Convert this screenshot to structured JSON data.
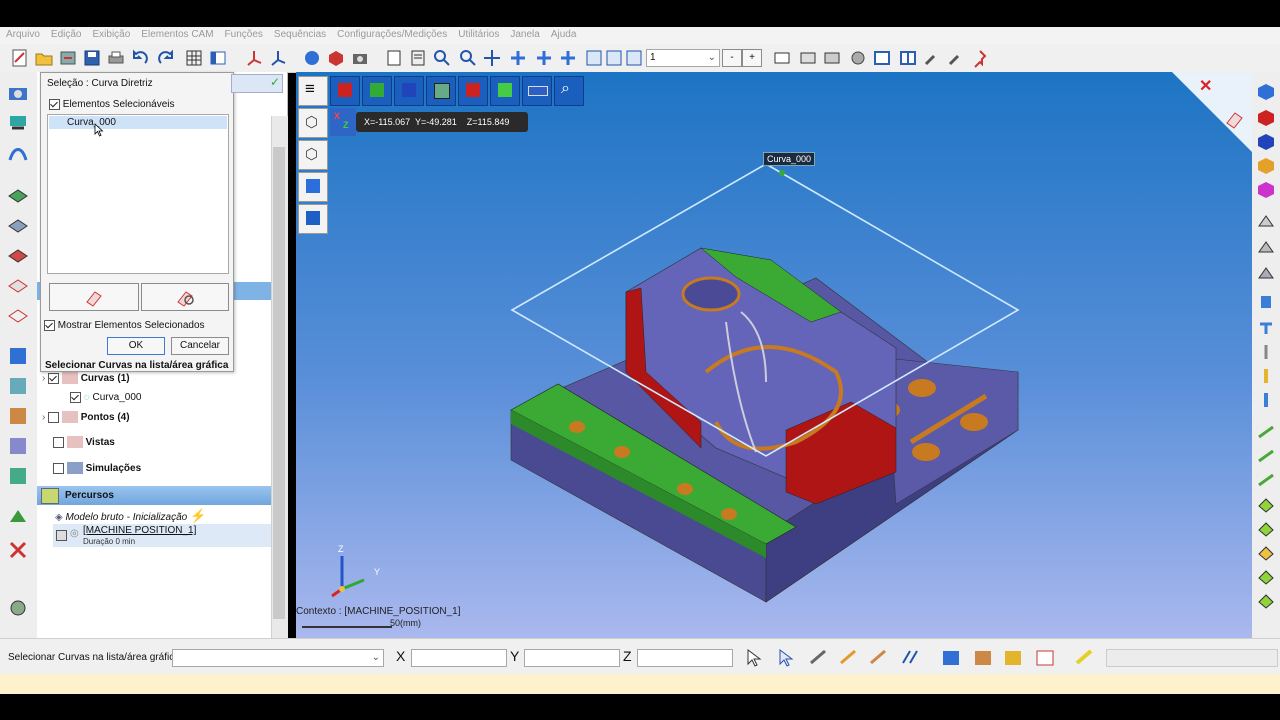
{
  "menu": [
    "Arquivo",
    "Edição",
    "Exibição",
    "Elementos CAM",
    "Funções",
    "Sequências",
    "Configurações/Medições",
    "Utilitários",
    "Janela",
    "Ajuda"
  ],
  "toolbar": {
    "layer_value": "1",
    "minus": "-",
    "plus": "+"
  },
  "dialog": {
    "title": "Seleção : Curva Diretriz",
    "selectable_label": "Elementos Selecionáveis",
    "list_items": [
      "Curva_000"
    ],
    "show_selected_label": "Mostrar Elementos Selecionados",
    "ok_label": "OK",
    "cancel_label": "Cancelar",
    "prompt": "Selecionar Curvas na lista/área gráfica"
  },
  "tree": {
    "curves_label": "Curvas (1)",
    "curve_child": "Curva_000",
    "points_label": "Pontos (4)",
    "views_label": "Vistas",
    "sims_label": "Simulações"
  },
  "paths": {
    "header": "Percursos",
    "raw_model": "Modelo bruto - Inicialização",
    "machine_pos": "[MACHINE POSITION_1]",
    "duration": "Duração 0 min"
  },
  "viewport": {
    "coords": "X=-115.067  Y=-49.281    Z=115.849",
    "curve_tag": "Curva_000",
    "context": "Contexto : [MACHINE_POSITION_1]",
    "scale": "50(mm)",
    "axis_z": "Z",
    "axis_y": "Y"
  },
  "status": {
    "prompt": "Selecionar Curvas na lista/área gráfica",
    "x_label": "X",
    "y_label": "Y",
    "z_label": "Z"
  },
  "colors": {
    "part": "#5a5aa8",
    "green": "#3aaa35",
    "red": "#b01515",
    "orange": "#c87a20",
    "curve": "#cfeaff"
  }
}
